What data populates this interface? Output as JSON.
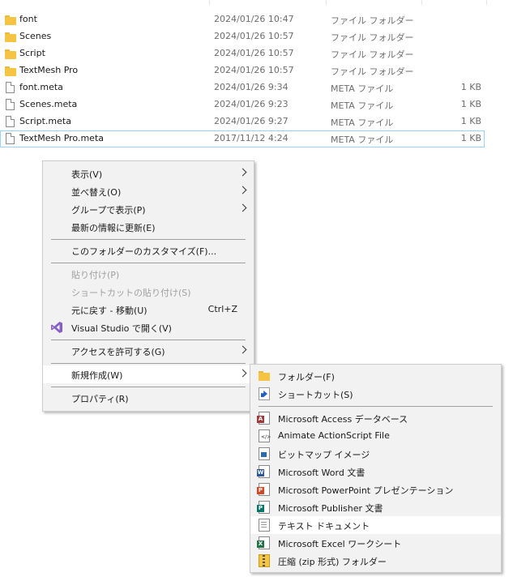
{
  "files": [
    {
      "name": "font",
      "date": "2024/01/26 10:47",
      "type": "ファイル フォルダー",
      "size": "",
      "kind": "folder"
    },
    {
      "name": "Scenes",
      "date": "2024/01/26 10:57",
      "type": "ファイル フォルダー",
      "size": "",
      "kind": "folder"
    },
    {
      "name": "Script",
      "date": "2024/01/26 10:57",
      "type": "ファイル フォルダー",
      "size": "",
      "kind": "folder"
    },
    {
      "name": "TextMesh Pro",
      "date": "2024/01/26 10:57",
      "type": "ファイル フォルダー",
      "size": "",
      "kind": "folder"
    },
    {
      "name": "font.meta",
      "date": "2024/01/26 9:34",
      "type": "META ファイル",
      "size": "1 KB",
      "kind": "file"
    },
    {
      "name": "Scenes.meta",
      "date": "2024/01/26 9:23",
      "type": "META ファイル",
      "size": "1 KB",
      "kind": "file"
    },
    {
      "name": "Script.meta",
      "date": "2024/01/26 9:27",
      "type": "META ファイル",
      "size": "1 KB",
      "kind": "file"
    },
    {
      "name": "TextMesh Pro.meta",
      "date": "2017/11/12 4:24",
      "type": "META ファイル",
      "size": "1 KB",
      "kind": "file",
      "selected": true
    }
  ],
  "context_menu": {
    "view": "表示(V)",
    "sort": "並べ替え(O)",
    "group": "グループで表示(P)",
    "refresh": "最新の情報に更新(E)",
    "customize": "このフォルダーのカスタマイズ(F)...",
    "paste": "貼り付け(P)",
    "paste_shortcut": "ショートカットの貼り付け(S)",
    "undo": "元に戻す - 移動(U)",
    "undo_shortcut": "Ctrl+Z",
    "open_vs": "Visual Studio で開く(V)",
    "grant_access": "アクセスを許可する(G)",
    "new": "新規作成(W)",
    "properties": "プロパティ(R)"
  },
  "new_submenu": {
    "folder": "フォルダー(F)",
    "shortcut": "ショートカット(S)",
    "access": "Microsoft Access データベース",
    "animate": "Animate ActionScript File",
    "bitmap": "ビットマップ イメージ",
    "word": "Microsoft Word 文書",
    "powerpoint": "Microsoft PowerPoint プレゼンテーション",
    "publisher": "Microsoft Publisher 文書",
    "text": "テキスト ドキュメント",
    "excel": "Microsoft Excel ワークシート",
    "zip": "圧縮 (zip 形式) フォルダー"
  },
  "colors": {
    "folder": "#f5c443",
    "selection_border": "#99d1ff",
    "menu_bg": "#f2f2f2",
    "vs_purple": "#865fc5",
    "access": "#a4373a",
    "word": "#2b579a",
    "powerpoint": "#d24726",
    "publisher": "#077568",
    "excel": "#217346"
  }
}
